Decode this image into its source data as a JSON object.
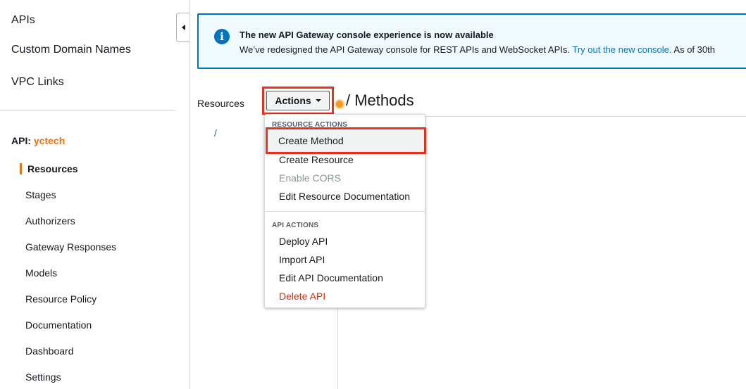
{
  "sidebar": {
    "top_links": [
      {
        "label": "APIs"
      },
      {
        "label": "Custom Domain Names"
      },
      {
        "label": "VPC Links"
      }
    ],
    "api_prefix": "API:",
    "api_name": "yctech",
    "nav_items": [
      {
        "label": "Resources",
        "active": true
      },
      {
        "label": "Stages"
      },
      {
        "label": "Authorizers"
      },
      {
        "label": "Gateway Responses"
      },
      {
        "label": "Models"
      },
      {
        "label": "Resource Policy"
      },
      {
        "label": "Documentation"
      },
      {
        "label": "Dashboard"
      },
      {
        "label": "Settings"
      }
    ]
  },
  "banner": {
    "icon": "info-icon",
    "title": "The new API Gateway console experience is now available",
    "body": "We’ve redesigned the API Gateway console for REST APIs and WebSocket APIs. ",
    "link": "Try out the new console.",
    "body_suffix": " As of 30th"
  },
  "main": {
    "resources_label": "Resources",
    "actions_label": "Actions",
    "methods_title": "/ Methods",
    "tree_root": "/"
  },
  "dropdown": {
    "resource_actions_header": "RESOURCE ACTIONS",
    "resource_actions": [
      {
        "label": "Create Method"
      },
      {
        "label": "Create Resource"
      },
      {
        "label": "Enable CORS",
        "disabled": true
      },
      {
        "label": "Edit Resource Documentation"
      }
    ],
    "api_actions_header": "API ACTIONS",
    "api_actions": [
      {
        "label": "Deploy API"
      },
      {
        "label": "Import API"
      },
      {
        "label": "Edit API Documentation"
      },
      {
        "label": "Delete API",
        "danger": true
      }
    ]
  },
  "colors": {
    "accent_orange": "#ec7211",
    "link_blue": "#0073bb",
    "highlight_red": "#e8301c",
    "danger_red": "#d13212"
  }
}
